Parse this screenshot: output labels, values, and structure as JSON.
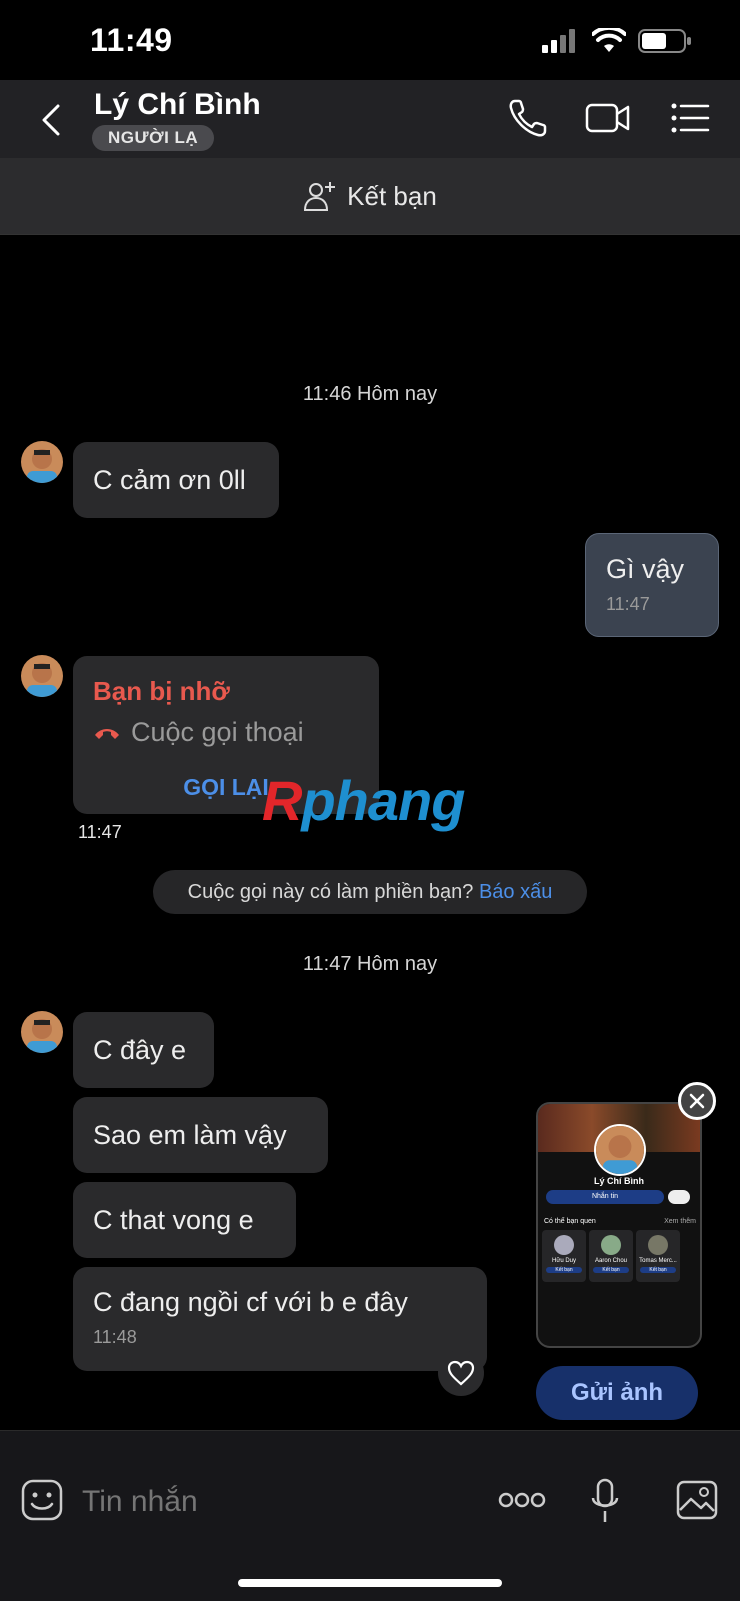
{
  "status_bar": {
    "time": "11:49"
  },
  "header": {
    "contact_name": "Lý Chí Bình",
    "badge": "NGƯỜI LẠ",
    "add_friend_label": "Kết bạn"
  },
  "conversation": {
    "time_header_1": "11:46 Hôm nay",
    "msg_1": "C cảm ơn 0ll",
    "outgoing_msg": "Gì vậy",
    "outgoing_time": "11:47",
    "missed_call": {
      "title": "Bạn bị nhỡ",
      "subtitle": "Cuộc gọi thoại",
      "callback_label": "GỌI LẠI",
      "time": "11:47"
    },
    "report_prompt": "Cuộc gọi này có làm phiền bạn?",
    "report_link": "Báo xấu",
    "time_header_2": "11:47 Hôm nay",
    "msg_2": "C đây e",
    "msg_3": "Sao em làm vậy",
    "msg_4": "C that vong  e",
    "msg_5": "C đang  ngồi  cf với  b e đây",
    "msg_5_time": "11:48"
  },
  "photo_suggestion": {
    "send_label": "Gửi ảnh",
    "thumb_name": "Lý Chí Bình",
    "thumb_message_btn": "Nhắn tin",
    "thumb_section": "Có thể bạn quen",
    "thumb_see_more": "Xem thêm",
    "thumb_people": [
      "Hữu Duy",
      "Aaron Chou",
      "Tomas Merc..."
    ],
    "thumb_add": "Kết bạn"
  },
  "composer": {
    "placeholder": "Tin nhắn"
  },
  "watermark": "Rphang",
  "colors": {
    "accent_blue": "#4c8fe8",
    "missed_red": "#e8594e",
    "header_bg": "#222225",
    "bubble_in": "#2a2a2c",
    "bubble_out": "#3b4350"
  }
}
